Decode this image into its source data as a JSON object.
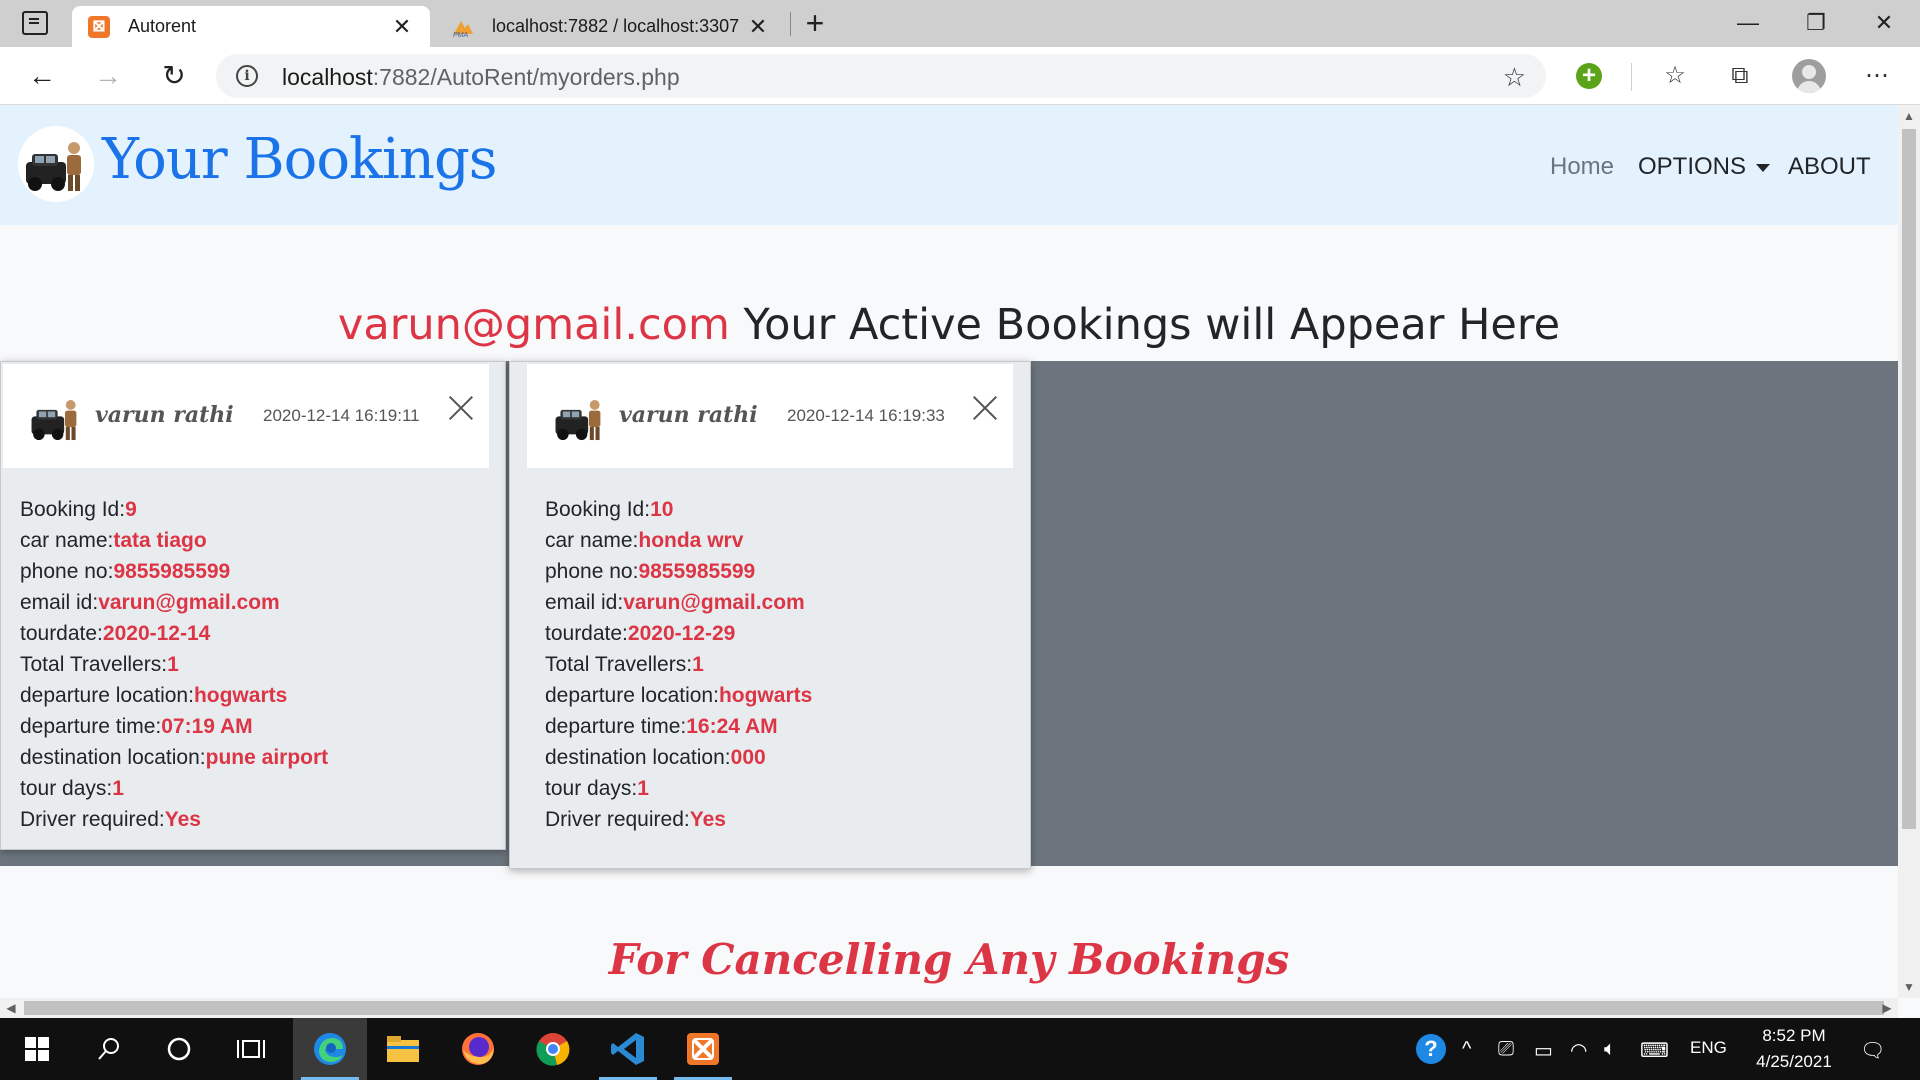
{
  "browser": {
    "tabs": [
      {
        "title": "Autorent",
        "active": true
      },
      {
        "title": "localhost:7882 / localhost:3307 /",
        "active": false
      }
    ],
    "url_host": "localhost",
    "url_rest": ":7882/AutoRent/myorders.php"
  },
  "site": {
    "brand_title": "Your Bookings",
    "nav": {
      "home": "Home",
      "options": "OPTIONS",
      "about": "ABOUT"
    },
    "heading_email": "varun@gmail.com",
    "heading_text": " Your Active Bookings will Appear Here",
    "cancel_heading": "For Cancelling Any Bookings"
  },
  "bookings": [
    {
      "user": "varun rathi",
      "timestamp": "2020-12-14 16:19:11",
      "fields": [
        {
          "label": "Booking Id:",
          "value": "9"
        },
        {
          "label": "car name:",
          "value": "tata tiago"
        },
        {
          "label": "phone no:",
          "value": "9855985599"
        },
        {
          "label": "email id:",
          "value": "varun@gmail.com"
        },
        {
          "label": "tourdate:",
          "value": "2020-12-14"
        },
        {
          "label": "Total Travellers:",
          "value": "1"
        },
        {
          "label": "departure location:",
          "value": "hogwarts"
        },
        {
          "label": "departure time:",
          "value": "07:19 AM"
        },
        {
          "label": "destination location:",
          "value": "pune airport"
        },
        {
          "label": "tour days:",
          "value": "1"
        },
        {
          "label": "Driver required:",
          "value": "Yes"
        }
      ]
    },
    {
      "user": "varun rathi",
      "timestamp": "2020-12-14 16:19:33",
      "fields": [
        {
          "label": "Booking Id:",
          "value": "10"
        },
        {
          "label": "car name:",
          "value": "honda wrv"
        },
        {
          "label": "phone no:",
          "value": "9855985599"
        },
        {
          "label": "email id:",
          "value": "varun@gmail.com"
        },
        {
          "label": "tourdate:",
          "value": "2020-12-29"
        },
        {
          "label": "Total Travellers:",
          "value": "1"
        },
        {
          "label": "departure location:",
          "value": "hogwarts"
        },
        {
          "label": "departure time:",
          "value": "16:24 AM"
        },
        {
          "label": "destination location:",
          "value": "000"
        },
        {
          "label": "tour days:",
          "value": "1"
        },
        {
          "label": "Driver required:",
          "value": "Yes"
        }
      ]
    }
  ],
  "taskbar": {
    "language": "ENG",
    "time": "8:52 PM",
    "date": "4/25/2021"
  },
  "colors": {
    "accent_red": "#dc3545",
    "brand_blue": "#1a73e8",
    "navbar_bg": "#e3f2fd",
    "band_gray": "#6c757d"
  },
  "icons": [
    "tab-actions-icon",
    "xampp-icon",
    "phpmyadmin-icon",
    "back-icon",
    "forward-icon",
    "refresh-icon",
    "info-icon",
    "add-favorite-icon",
    "extension-icon",
    "favorites-icon",
    "collections-icon",
    "profile-icon",
    "more-icon",
    "windows-start-icon",
    "search-icon",
    "cortana-icon",
    "task-view-icon",
    "edge-icon",
    "file-explorer-icon",
    "firefox-icon",
    "chrome-icon",
    "vscode-icon",
    "help-icon",
    "wifi-icon",
    "volume-icon",
    "notification-icon"
  ]
}
